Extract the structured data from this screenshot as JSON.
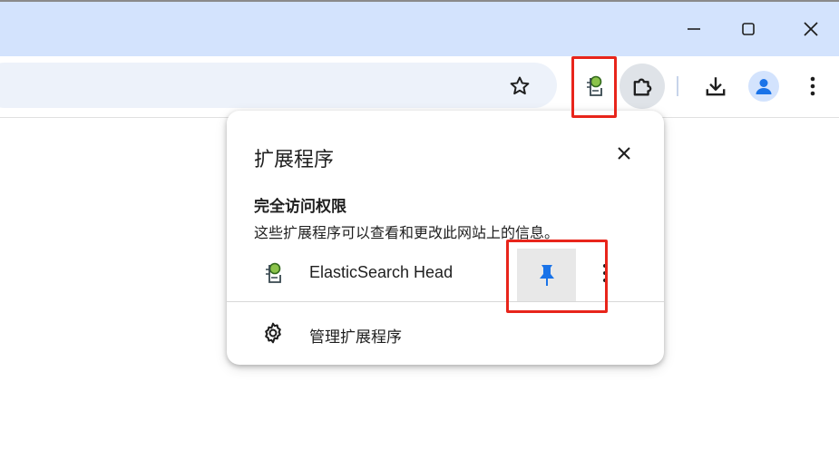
{
  "window": {
    "minimize_icon": "minimize-icon",
    "maximize_icon": "maximize-icon",
    "close_icon": "close-icon"
  },
  "toolbar": {
    "bookmark_icon": "star-icon",
    "pinned_extension_icon": "elasticsearch-head-icon",
    "extensions_icon": "puzzle-icon",
    "download_icon": "download-icon",
    "profile_icon": "avatar-icon",
    "menu_icon": "kebab-menu-icon"
  },
  "popup": {
    "title": "扩展程序",
    "section_heading": "完全访问权限",
    "section_description": "这些扩展程序可以查看和更改此网站上的信息。",
    "extensions": [
      {
        "name": "ElasticSearch Head",
        "pin_icon": "pin-icon"
      }
    ],
    "manage_label": "管理扩展程序"
  },
  "colors": {
    "titlebar": "#d3e3fd",
    "omnibox": "#edf2fa",
    "highlight_box": "#e8251b",
    "pin_blue": "#1a73e8",
    "avatar_blue": "#1a73e8"
  }
}
